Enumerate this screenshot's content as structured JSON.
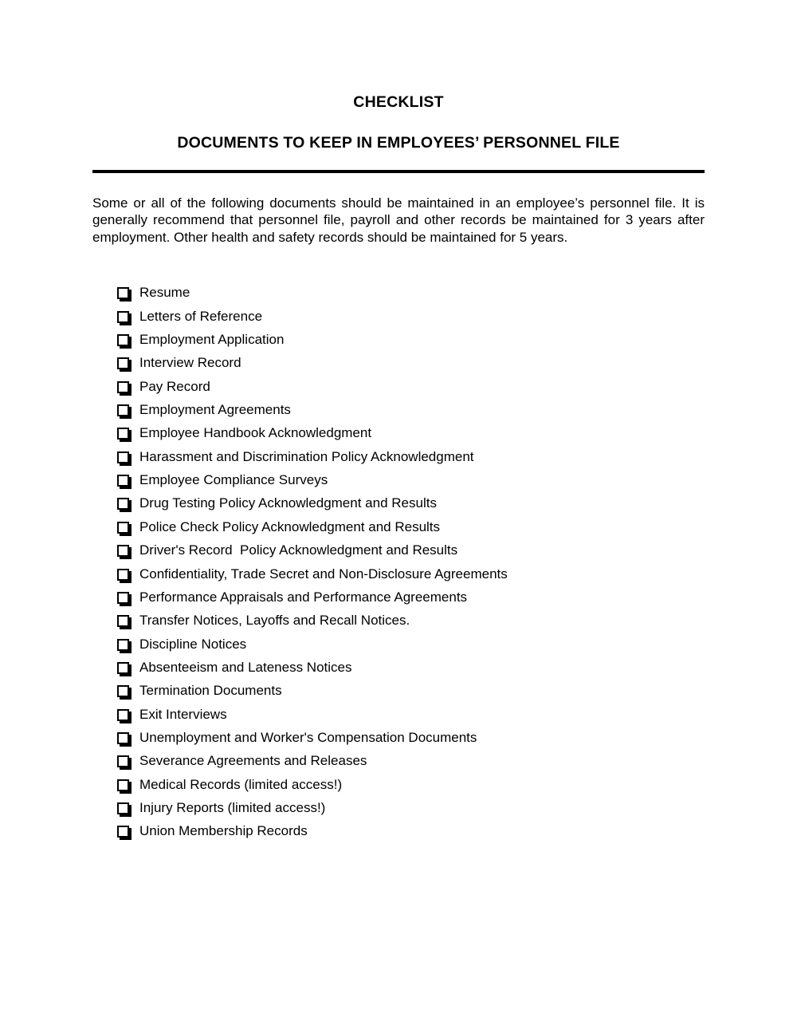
{
  "document": {
    "title_main": "CHECKLIST",
    "title_sub": "DOCUMENTS TO KEEP IN EMPLOYEES’ PERSONNEL FILE",
    "intro_paragraph": "Some or all of the following documents should be maintained in an employee’s personnel file. It is generally recommend that personnel file, payroll and other records be maintained for 3 years after employment. Other health and safety records should be maintained for 5 years.",
    "checkbox_icon": "empty-checkbox-icon",
    "colors": {
      "text": "#000000",
      "background": "#ffffff",
      "divider": "#000000"
    },
    "checklist": [
      {
        "label": "Resume"
      },
      {
        "label": "Letters of Reference"
      },
      {
        "label": "Employment Application"
      },
      {
        "label": "Interview Record"
      },
      {
        "label": "Pay Record"
      },
      {
        "label": "Employment Agreements"
      },
      {
        "label": "Employee Handbook Acknowledgment"
      },
      {
        "label": "Harassment and Discrimination Policy Acknowledgment"
      },
      {
        "label": "Employee Compliance Surveys"
      },
      {
        "label": "Drug Testing Policy Acknowledgment and Results"
      },
      {
        "label": "Police Check Policy Acknowledgment and Results"
      },
      {
        "label": "Driver's Record  Policy Acknowledgment and Results"
      },
      {
        "label": "Confidentiality, Trade Secret and Non-Disclosure Agreements"
      },
      {
        "label": "Performance Appraisals and Performance Agreements"
      },
      {
        "label": "Transfer Notices, Layoffs and Recall Notices."
      },
      {
        "label": "Discipline Notices"
      },
      {
        "label": "Absenteeism and Lateness Notices"
      },
      {
        "label": "Termination Documents"
      },
      {
        "label": "Exit Interviews"
      },
      {
        "label": "Unemployment and Worker's Compensation Documents"
      },
      {
        "label": "Severance Agreements and Releases"
      },
      {
        "label": "Medical Records (limited access!)"
      },
      {
        "label": "Injury Reports (limited access!)"
      },
      {
        "label": "Union Membership Records"
      }
    ]
  }
}
